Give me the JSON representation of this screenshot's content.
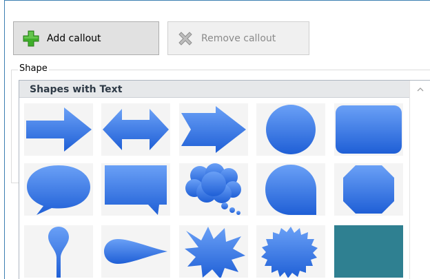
{
  "toolbar": {
    "add_label": "Add callout",
    "remove_label": "Remove callout"
  },
  "shape_group": {
    "label": "Shape",
    "gallery_title": "Shapes with Text"
  },
  "shapes": [
    {
      "name": "arrow-right"
    },
    {
      "name": "arrow-left-right"
    },
    {
      "name": "chevron-arrow"
    },
    {
      "name": "circle"
    },
    {
      "name": "rounded-rectangle"
    },
    {
      "name": "oval-callout"
    },
    {
      "name": "rectangle-callout"
    },
    {
      "name": "cloud-callout"
    },
    {
      "name": "round-corner-callout"
    },
    {
      "name": "octagon"
    },
    {
      "name": "pin"
    },
    {
      "name": "teardrop-horizontal"
    },
    {
      "name": "explosion"
    },
    {
      "name": "seal"
    },
    {
      "name": "square-teal"
    }
  ],
  "colors": {
    "shape_top": "#6aa0f6",
    "shape_bottom": "#1f5fd6",
    "teal": "#2f8091",
    "add_icon": "#3fae2a",
    "remove_icon": "#a8a8a8"
  }
}
